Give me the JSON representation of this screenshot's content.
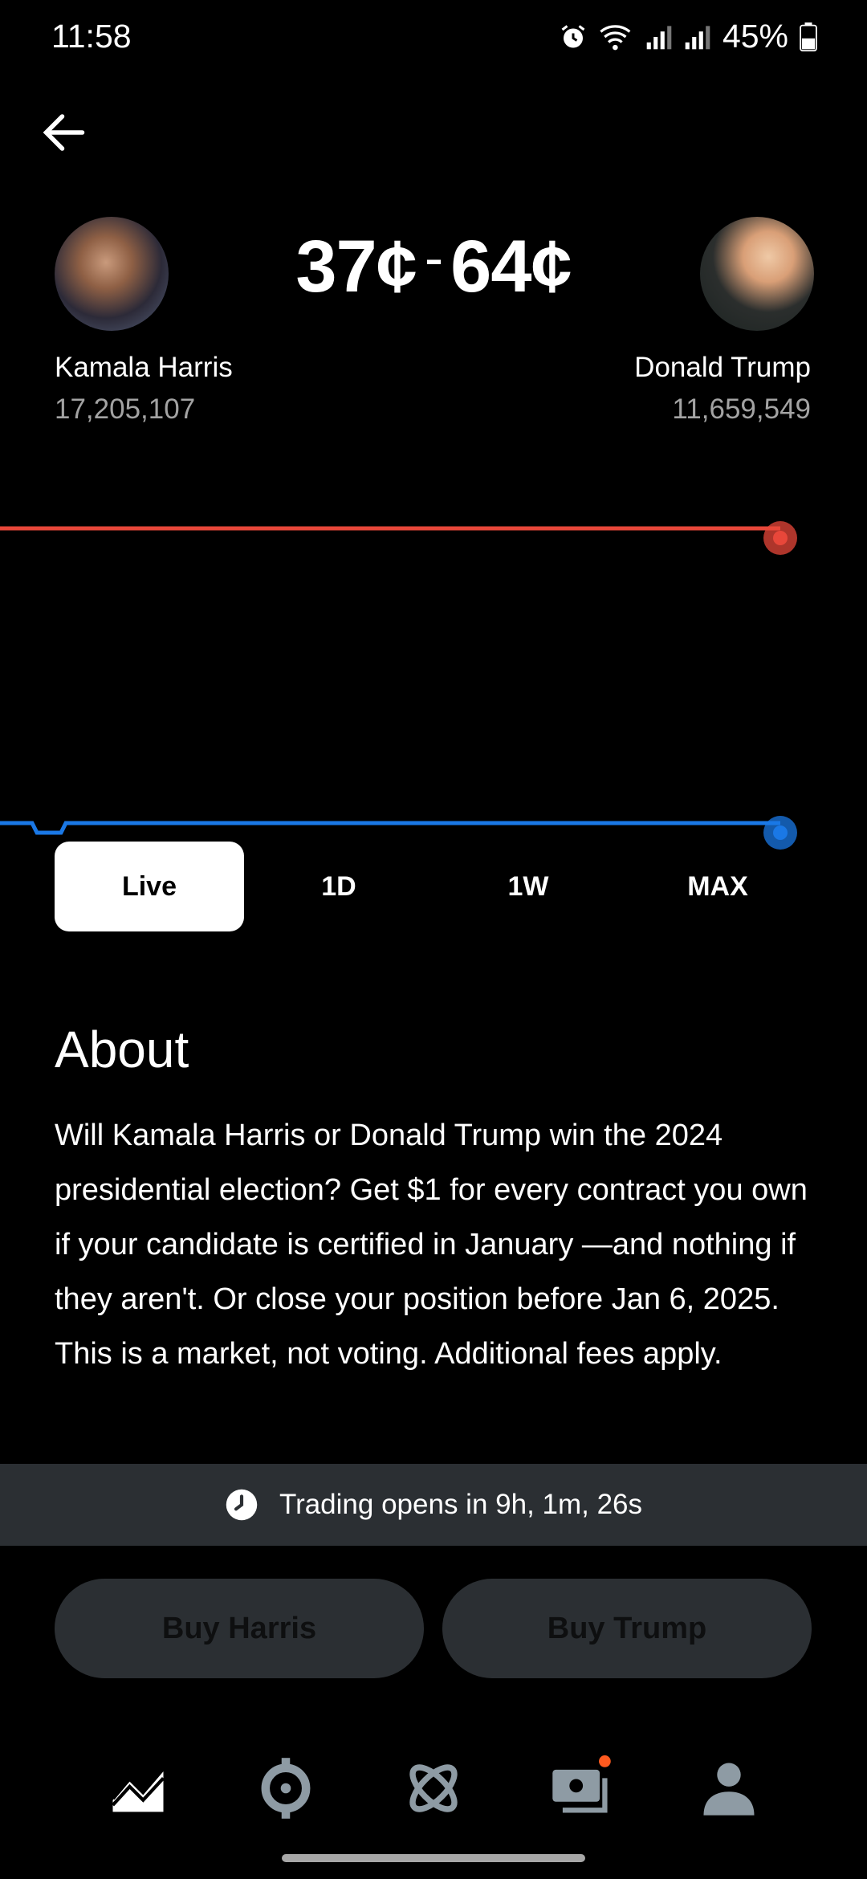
{
  "status_bar": {
    "time": "11:58",
    "battery": "45%"
  },
  "market": {
    "price_low": "37¢",
    "separator": "-",
    "price_high": "64¢",
    "candidates": [
      {
        "name": "Kamala Harris",
        "votes": "17,205,107",
        "color": "#e8473a"
      },
      {
        "name": "Donald Trump",
        "votes": "11,659,549",
        "color": "#1a78e6"
      }
    ]
  },
  "chart_data": {
    "type": "line",
    "series": [
      {
        "color": "#e8473a",
        "values": [
          37,
          37,
          37,
          37,
          37,
          37,
          37,
          37,
          37,
          37
        ]
      },
      {
        "color": "#1a78e6",
        "values": [
          64,
          64.5,
          64,
          64,
          64,
          64,
          64,
          64,
          64,
          64
        ]
      }
    ]
  },
  "range_tabs": [
    {
      "label": "Live",
      "active": true
    },
    {
      "label": "1D",
      "active": false
    },
    {
      "label": "1W",
      "active": false
    },
    {
      "label": "MAX",
      "active": false
    }
  ],
  "about": {
    "title": "About",
    "text": "Will Kamala Harris or Donald Trump win the 2024 presidential election? Get $1 for every contract you own if your candidate is certified in January —and nothing if they aren't. Or close your position before Jan 6, 2025. This is a market, not voting. Additional fees apply."
  },
  "trading_banner": {
    "text": "Trading opens in 9h, 1m, 26s",
    "icon": "clock-icon"
  },
  "buttons": {
    "buy_harris": "Buy Harris",
    "buy_trump": "Buy Trump"
  },
  "bottom_nav": [
    {
      "icon": "chart-icon",
      "active": true
    },
    {
      "icon": "crypto-icon",
      "active": false
    },
    {
      "icon": "orbit-icon",
      "active": false
    },
    {
      "icon": "wallet-icon",
      "active": false,
      "badge": true
    },
    {
      "icon": "profile-icon",
      "active": false
    }
  ],
  "colors": {
    "accent_red": "#e8473a",
    "accent_blue": "#1a78e6",
    "surface": "#2b2f33",
    "badge": "#ff5a1f"
  }
}
